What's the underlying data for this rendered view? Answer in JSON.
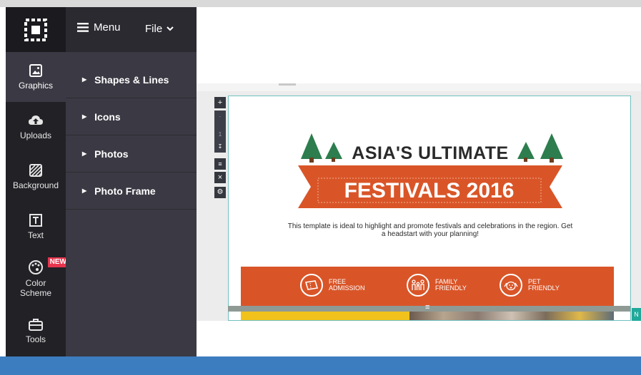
{
  "app": {
    "logo_icon": "selection-logo-icon",
    "colors": {
      "rail": "#222126",
      "panel": "#3b3a44",
      "accent_blue": "#3c7dbf",
      "canvas_orange": "#d95528",
      "tree_green": "#2d7d4e",
      "badge_red": "#e8354e"
    }
  },
  "toolbar": {
    "menu_label": "Menu",
    "menu_icon": "hamburger-icon",
    "file_label": "File",
    "file_icon": "chevron-down-icon"
  },
  "rail": {
    "items": [
      {
        "label": "Graphics",
        "icon": "image-icon",
        "active": true
      },
      {
        "label": "Uploads",
        "icon": "cloud-upload-icon"
      },
      {
        "label": "Background",
        "icon": "hatch-pattern-icon"
      },
      {
        "label": "Text",
        "icon": "text-box-icon"
      },
      {
        "label": "Color Scheme",
        "icon": "palette-icon",
        "badge": "NEW"
      },
      {
        "label": "Tools",
        "icon": "toolbox-icon"
      }
    ]
  },
  "panel": {
    "categories": [
      {
        "label": "Shapes & Lines"
      },
      {
        "label": "Icons"
      },
      {
        "label": "Photos"
      },
      {
        "label": "Photo Frame"
      }
    ]
  },
  "editor": {
    "tools": {
      "add": "+",
      "collapse": "↧",
      "align": "≡",
      "delete": "×",
      "settings": "⚙"
    },
    "strip_page": "1"
  },
  "canvas": {
    "heading_top": "ASIA'S ULTIMATE",
    "heading_main": "FESTIVALS 2016",
    "description": "This template is ideal to highlight and promote festivals and celebrations in the region. Get a headstart with your planning!",
    "features": [
      {
        "line1": "FREE",
        "line2": "ADMISSION",
        "icon": "ticket-icon"
      },
      {
        "line1": "FAMILY",
        "line2": "FRIENDLY",
        "icon": "family-icon"
      },
      {
        "line1": "PET",
        "line2": "FRIENDLY",
        "icon": "dog-icon"
      }
    ],
    "edge_tab": "N"
  }
}
